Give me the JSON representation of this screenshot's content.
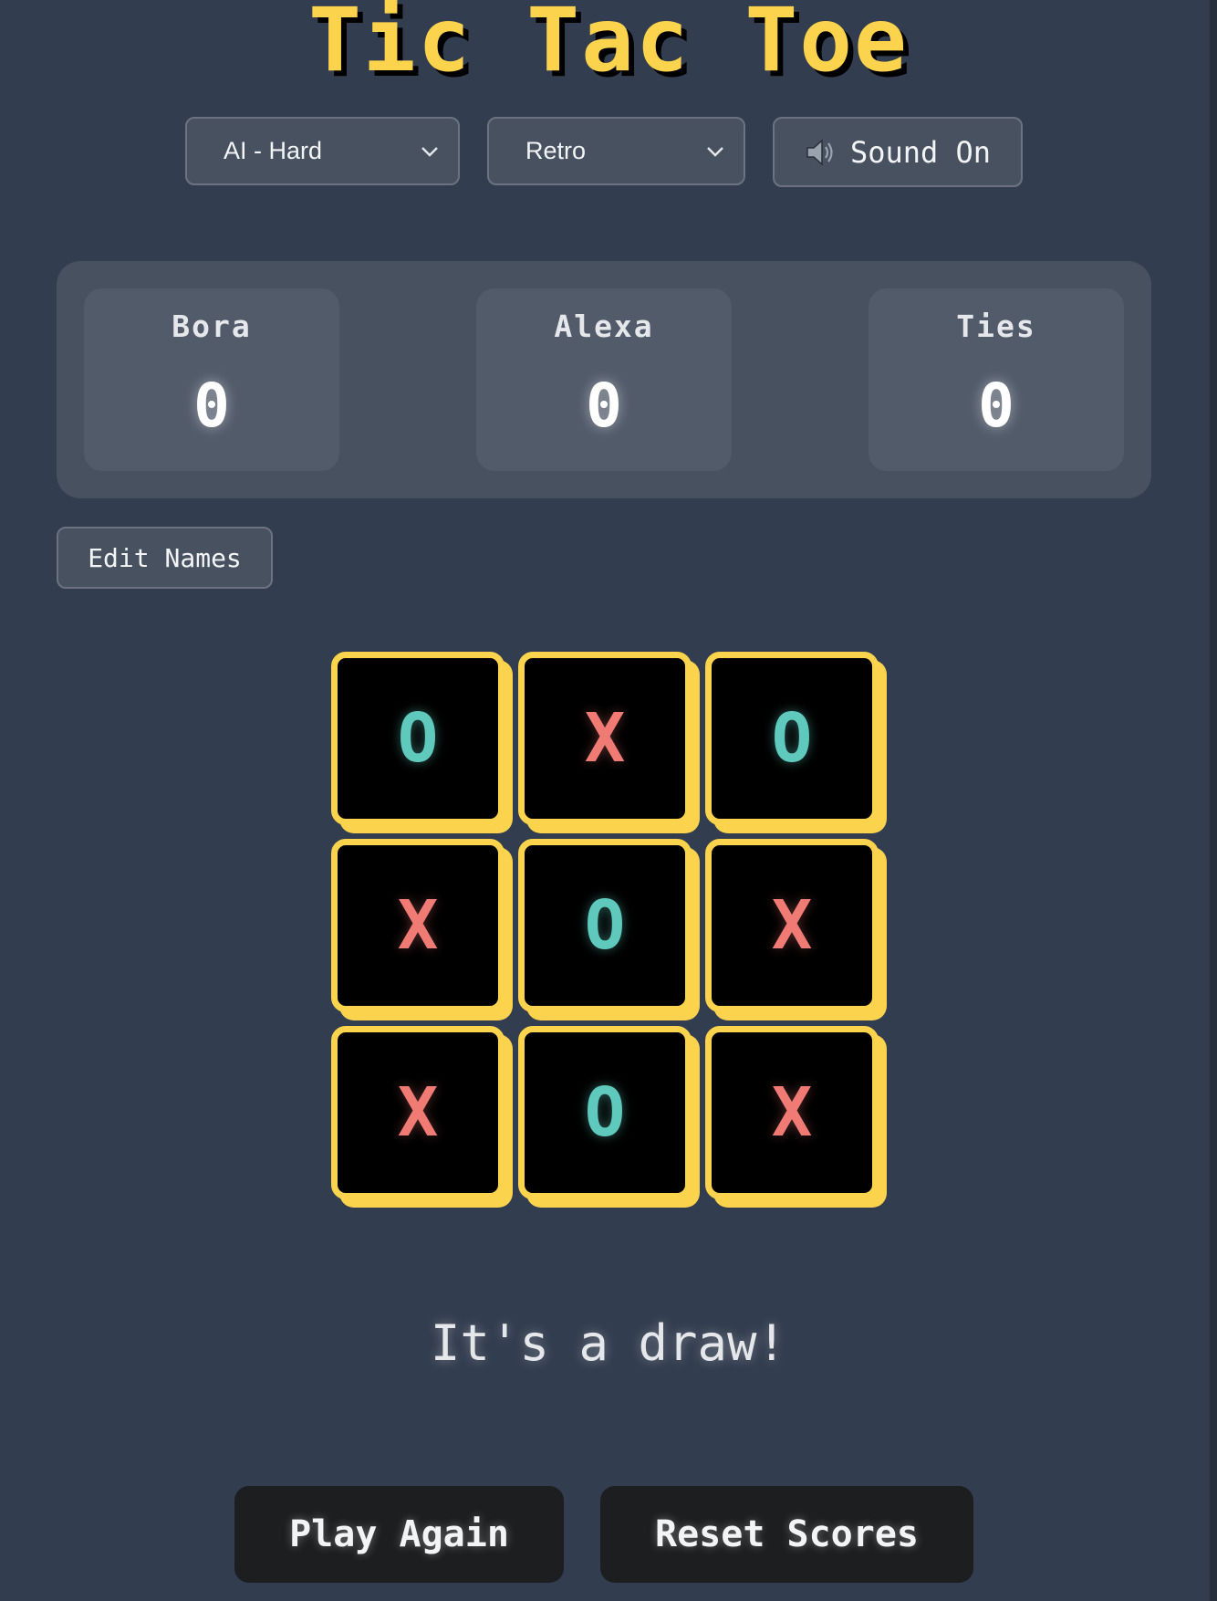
{
  "title": "Tic Tac Toe",
  "controls": {
    "mode_select": {
      "selected": "AI - Hard",
      "icon": "chevron-down-icon"
    },
    "theme_select": {
      "selected": "Retro",
      "icon": "chevron-down-icon"
    },
    "sound_button": {
      "icon": "speaker-icon",
      "label": "Sound On"
    }
  },
  "scoreboard": {
    "players": [
      {
        "name": "Bora",
        "score": "0"
      },
      {
        "name": "Alexa",
        "score": "0"
      },
      {
        "name": "Ties",
        "score": "0"
      }
    ]
  },
  "edit_names_label": "Edit Names",
  "board": {
    "cells": [
      "O",
      "X",
      "O",
      "X",
      "O",
      "X",
      "X",
      "O",
      "X"
    ]
  },
  "status": "It's a draw!",
  "actions": {
    "play_again": "Play Again",
    "reset_scores": "Reset Scores"
  },
  "colors": {
    "background": "#323d4f",
    "accent": "#fcd34d",
    "x_mark": "#f07b75",
    "o_mark": "#5fc9bd"
  }
}
